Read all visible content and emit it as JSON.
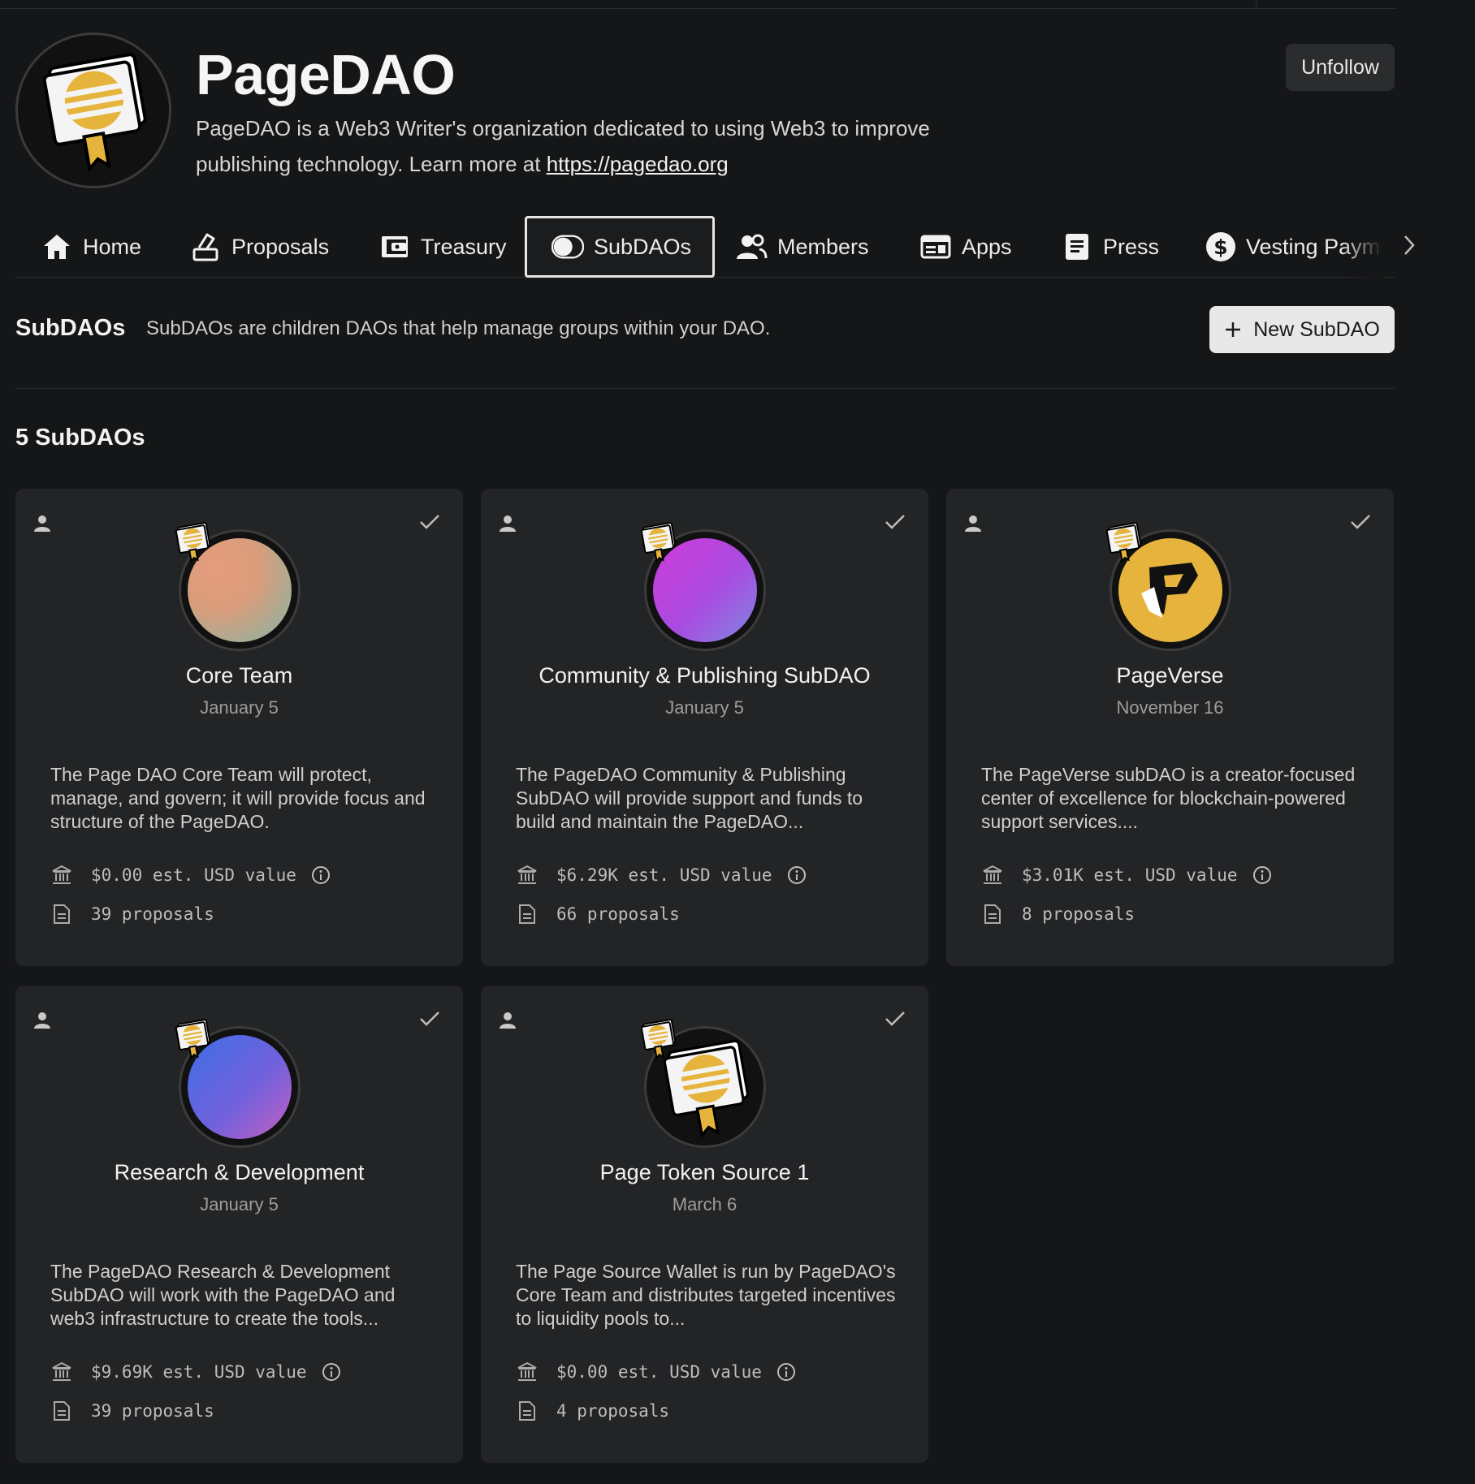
{
  "dao": {
    "name": "PageDAO",
    "description": "PageDAO is a Web3 Writer's organization dedicated to using Web3 to improve publishing technology. Learn more at ",
    "link": "https://pagedao.org",
    "follow_label": "Unfollow"
  },
  "tabs": [
    {
      "label": "Home",
      "icon": "home-icon"
    },
    {
      "label": "Proposals",
      "icon": "proposals-icon"
    },
    {
      "label": "Treasury",
      "icon": "wallet-icon"
    },
    {
      "label": "SubDAOs",
      "icon": "toggle-icon",
      "active": true
    },
    {
      "label": "Members",
      "icon": "members-icon"
    },
    {
      "label": "Apps",
      "icon": "apps-icon"
    },
    {
      "label": "Press",
      "icon": "document-icon"
    },
    {
      "label": "Vesting Paym",
      "icon": "dollar-icon"
    }
  ],
  "section": {
    "title": "SubDAOs",
    "description": "SubDAOs are children DAOs that help manage groups within your DAO.",
    "new_button": "New SubDAO",
    "count_label": "5 SubDAOs"
  },
  "subdaos": [
    {
      "name": "Core Team",
      "date": "January 5",
      "description": "The Page DAO Core Team will protect, manage, and govern; it will provide focus and structure of the PageDAO.",
      "usd": "$0.00 est. USD value",
      "proposals": "39 proposals",
      "avatar": "gradient-peach"
    },
    {
      "name": "Community & Publishing SubDAO",
      "date": "January 5",
      "description": "The PageDAO Community & Publishing SubDAO will provide support and funds to build and maintain the PageDAO...",
      "usd": "$6.29K est. USD value",
      "proposals": "66 proposals",
      "avatar": "gradient-purple"
    },
    {
      "name": "PageVerse",
      "date": "November 16",
      "description": "The PageVerse subDAO is a creator-focused center of excellence for blockchain-powered support services....",
      "usd": "$3.01K est. USD value",
      "proposals": "8 proposals",
      "avatar": "pageverse-logo"
    },
    {
      "name": "Research & Development",
      "date": "January 5",
      "description": "The PageDAO Research & Development SubDAO will work with the PageDAO and web3 infrastructure to create the tools...",
      "usd": "$9.69K est. USD value",
      "proposals": "39 proposals",
      "avatar": "gradient-blue"
    },
    {
      "name": "Page Token Source 1",
      "date": "March 6",
      "description": "The Page Source Wallet is run by PageDAO's Core Team and distributes targeted incentives to liquidity pools to...",
      "usd": "$0.00 est. USD value",
      "proposals": "4 proposals",
      "avatar": "pagedao-logo"
    }
  ],
  "colors": {
    "background": "#151617",
    "card": "#232426",
    "accent_gold": "#e6b43c"
  }
}
